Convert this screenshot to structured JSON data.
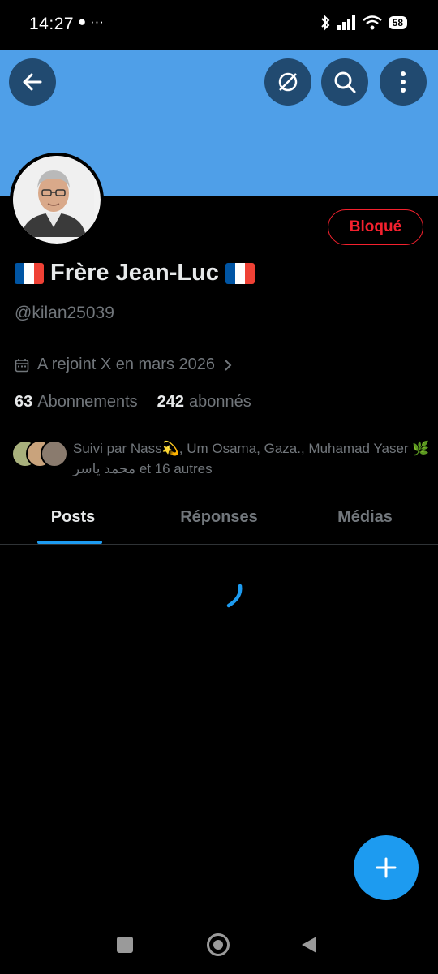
{
  "status_bar": {
    "time": "14:27",
    "notification_icons": "● ···",
    "battery": "58",
    "icons": [
      "bluetooth-icon",
      "signal-icon",
      "wifi-icon",
      "battery-icon"
    ]
  },
  "header": {
    "banner_color": "#4f9fe8",
    "buttons": [
      "back-icon",
      "grok-icon",
      "search-icon",
      "more-icon"
    ]
  },
  "profile": {
    "name": "Frère Jean-Luc",
    "handle": "@kilan25039",
    "blocked_label": "Bloqué",
    "joined": "A rejoint X en mars 2026",
    "following_count": "63",
    "following_label": "Abonnements",
    "followers_count": "242",
    "followers_label": "abonnés",
    "followed_by": "Suivi par Nass💫, Um Osama, Gaza., Muhamad Yaser 🌿 محمد ياسر et 16 autres"
  },
  "tabs": [
    {
      "label": "Posts",
      "active": true
    },
    {
      "label": "Réponses",
      "active": false
    },
    {
      "label": "Médias",
      "active": false
    }
  ],
  "colors": {
    "accent": "#1d9bf0",
    "blocked": "#f4212e"
  }
}
